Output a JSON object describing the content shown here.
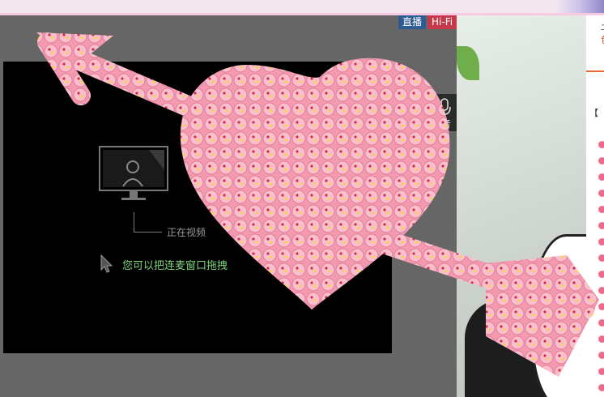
{
  "player": {
    "badge_live": "直播",
    "badge_hifi": "Hi-Fi",
    "status_text": "正在视频",
    "hint_text": "您可以把连麦窗口拖拽",
    "mic_label": "音"
  },
  "side_panel": {
    "char_top": "土",
    "char_red": "包",
    "bracket": "【"
  },
  "overlay": {
    "name": "heart-arrow-sticker-effect",
    "color": "#f7a6b8"
  }
}
